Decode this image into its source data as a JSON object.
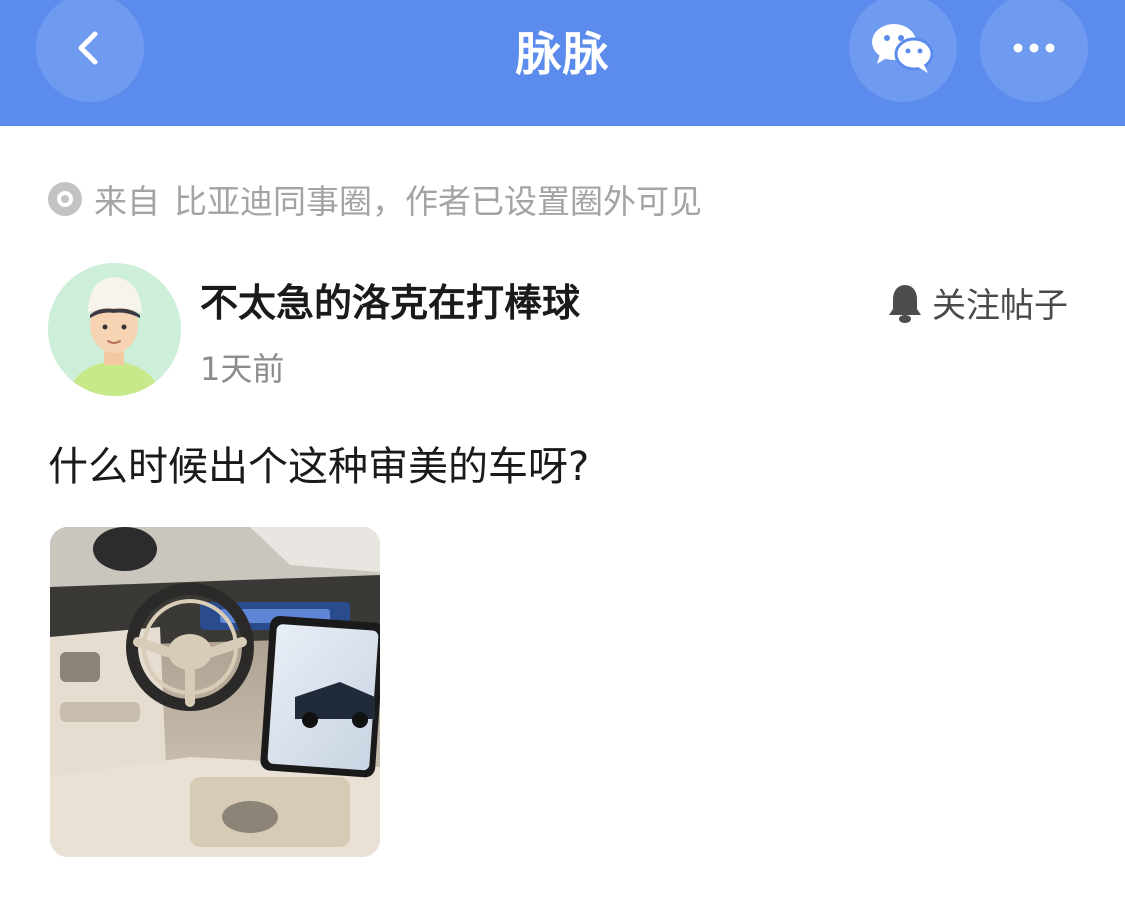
{
  "header": {
    "title": "脉脉",
    "back_icon": "chevron-left-icon",
    "share_icon": "wechat-icon",
    "more_icon": "more-dots-icon",
    "accent_color": "#5b8ced"
  },
  "source": {
    "prefix": "来自",
    "circle": "比亚迪同事圈，作者已设置圈外可见"
  },
  "post": {
    "author": "不太急的洛克在打棒球",
    "time": "1天前",
    "follow_label": "关注帖子",
    "text": "什么时候出个这种审美的车呀?"
  }
}
